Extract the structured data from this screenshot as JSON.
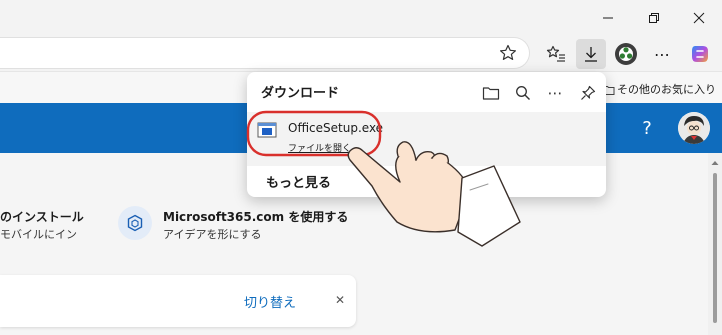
{
  "toolbar": {
    "more_glyph": "⋯"
  },
  "favorites": {
    "other_label": "その他のお気に入り"
  },
  "downloads": {
    "title": "ダウンロード",
    "more_glyph": "⋯",
    "item": {
      "filename": "OfficeSetup.exe",
      "action": "ファイルを開く"
    },
    "see_more": "もっと見る"
  },
  "header": {
    "help_glyph": "?"
  },
  "features": [
    {
      "title": "のインストール",
      "subtitle": "モバイルにイン"
    },
    {
      "title": "Microsoft365.com を使用する",
      "subtitle": "アイデアを形にする"
    }
  ],
  "notice": {
    "switch_label": "切り替え",
    "close_glyph": "✕"
  },
  "colors": {
    "brand_blue": "#0f6cbd",
    "highlight_red": "#d9302c"
  }
}
